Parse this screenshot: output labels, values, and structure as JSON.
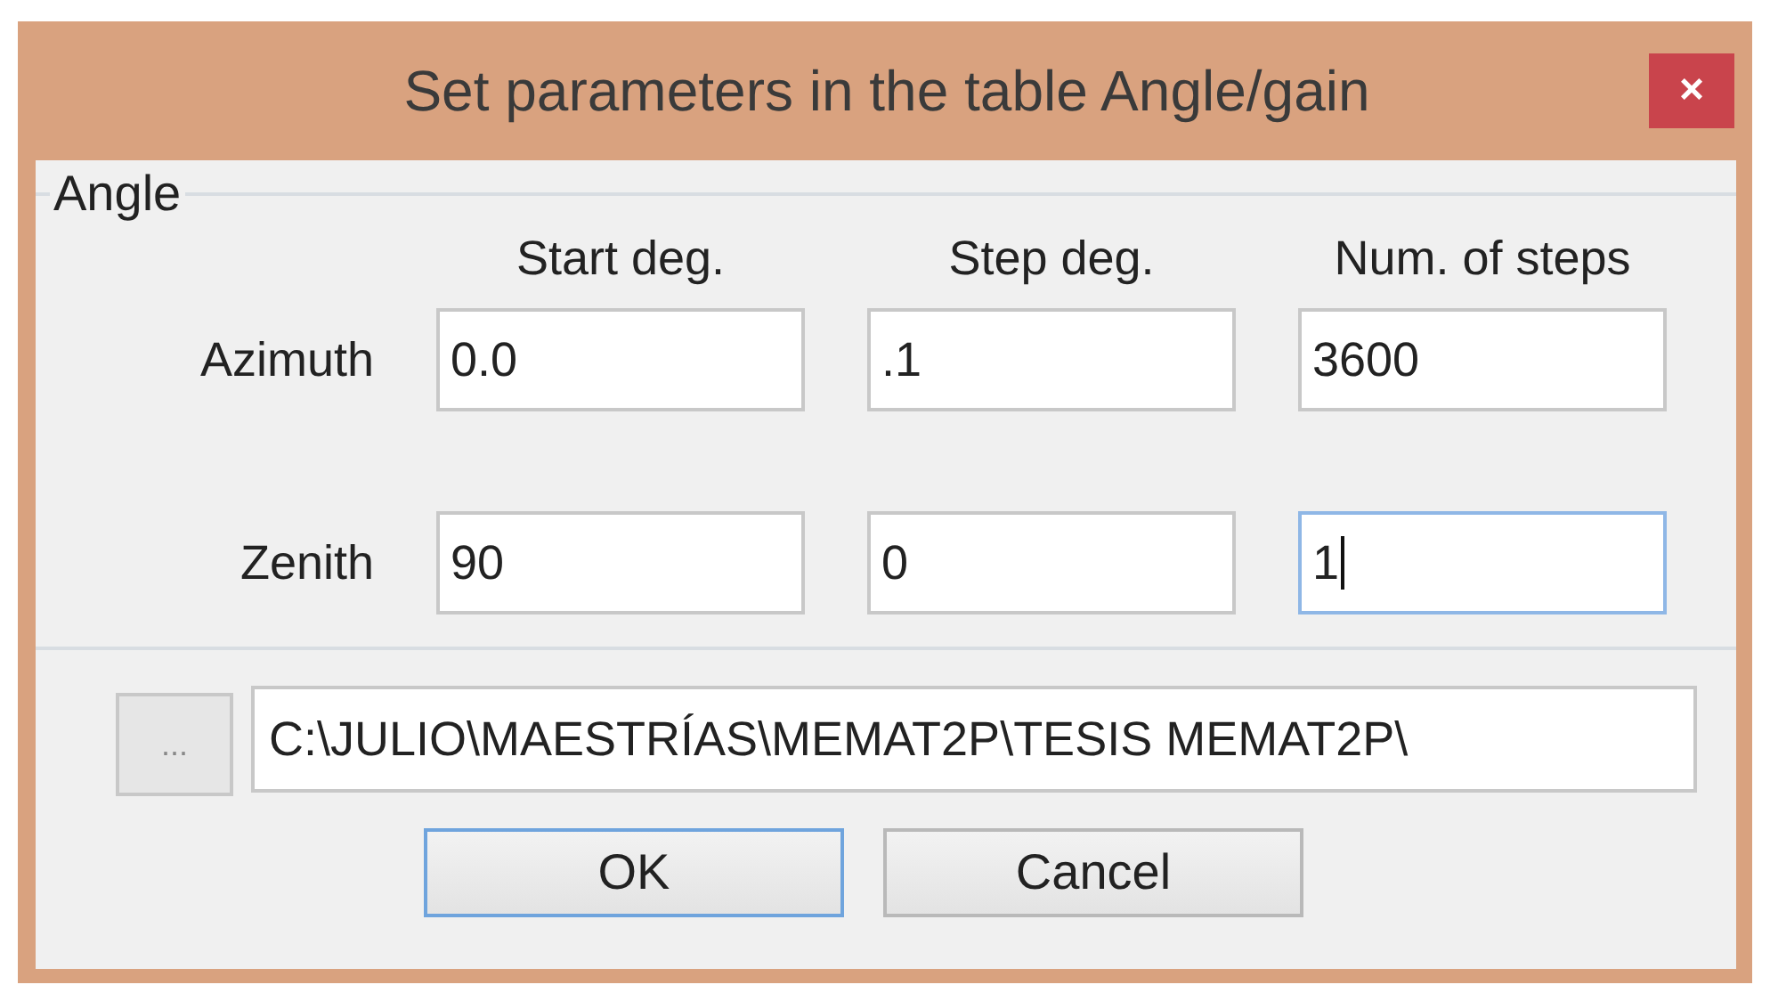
{
  "window": {
    "title": "Set parameters in the table Angle/gain",
    "close": "×"
  },
  "group": {
    "label": "Angle",
    "columns": [
      "Start deg.",
      "Step deg.",
      "Num. of steps"
    ],
    "rows": [
      {
        "label": "Azimuth",
        "fields": [
          {
            "value": "0.0",
            "focused": false
          },
          {
            "value": ".1",
            "focused": false
          },
          {
            "value": "3600",
            "focused": false
          }
        ]
      },
      {
        "label": "Zenith",
        "fields": [
          {
            "value": "90",
            "focused": false
          },
          {
            "value": "0",
            "focused": false
          },
          {
            "value": "1",
            "focused": true
          }
        ]
      }
    ]
  },
  "path": {
    "browse": "...",
    "value": "C:\\JULIO\\MAESTRÍAS\\MEMAT2P\\TESIS MEMAT2P\\"
  },
  "buttons": [
    {
      "label": "OK",
      "default": true
    },
    {
      "label": "Cancel",
      "default": false
    }
  ]
}
